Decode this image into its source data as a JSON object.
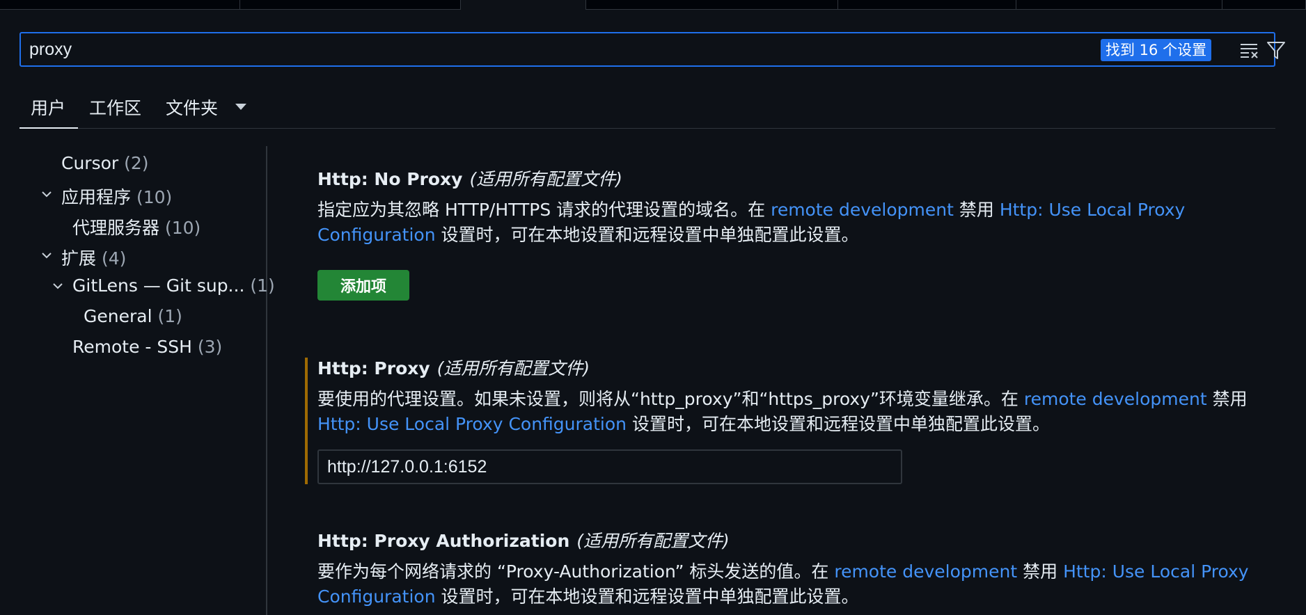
{
  "search": {
    "value": "proxy",
    "result_count": "找到 16 个设置"
  },
  "scope_tabs": {
    "user": "用户",
    "workspace": "工作区",
    "folder": "文件夹"
  },
  "toc": [
    {
      "label": "Cursor",
      "count": "(2)"
    },
    {
      "label": "应用程序",
      "count": "(10)"
    },
    {
      "label": "代理服务器",
      "count": "(10)"
    },
    {
      "label": "扩展",
      "count": "(4)"
    },
    {
      "label": "GitLens — Git sup...",
      "count": "(1)"
    },
    {
      "label": "General",
      "count": "(1)"
    },
    {
      "label": "Remote - SSH",
      "count": "(3)"
    }
  ],
  "settings": {
    "no_proxy": {
      "title": "Http: No Proxy",
      "scope": "(适用所有配置文件)",
      "desc_1": "指定应为其忽略 HTTP/HTTPS 请求的代理设置的域名。在 ",
      "link_1": "remote development",
      "desc_2": " 禁用 ",
      "link_2": "Http: Use Local Proxy Configuration",
      "desc_3": " 设置时，可在本地设置和远程设置中单独配置此设置。",
      "add_button": "添加项"
    },
    "proxy": {
      "title": "Http: Proxy",
      "scope": "(适用所有配置文件)",
      "desc_1": "要使用的代理设置。如果未设置，则将从“http_proxy”和“https_proxy”环境变量继承。在 ",
      "link_1": "remote development",
      "desc_2": " 禁用 ",
      "link_2": "Http: Use Local Proxy Configuration",
      "desc_3": " 设置时，可在本地设置和远程设置中单独配置此设置。",
      "value": "http://127.0.0.1:6152"
    },
    "proxy_auth": {
      "title": "Http: Proxy Authorization",
      "scope": "(适用所有配置文件)",
      "desc_1": "要作为每个网络请求的 “Proxy-Authorization” 标头发送的值。在 ",
      "link_1": "remote development",
      "desc_2": " 禁用 ",
      "link_2": "Http: Use Local Proxy Configuration",
      "desc_3": " 设置时，可在本地设置和远程设置中单独配置此设置。"
    }
  },
  "colors": {
    "accent": "#1f6feb",
    "link": "#4493f8",
    "button": "#238636",
    "modified": "#9e6a03"
  },
  "icons": [
    "clear-filter-icon",
    "filter-icon",
    "chevron-down-icon"
  ]
}
